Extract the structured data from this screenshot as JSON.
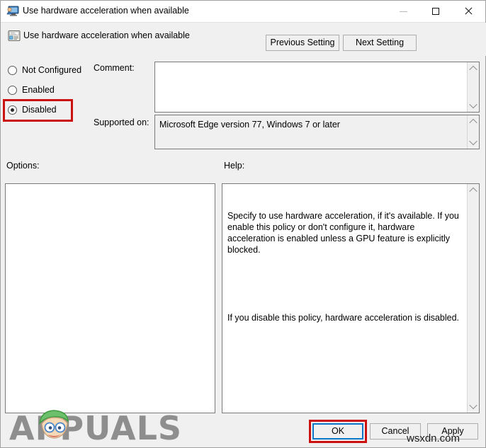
{
  "window": {
    "title": "Use hardware acceleration when available",
    "icon": "policy-monitor-icon",
    "minimize_label": "—",
    "maximize_label": "□",
    "close_label": "✕"
  },
  "header": {
    "title": "Use hardware acceleration when available",
    "icon": "policy-setting-icon",
    "previous_setting": "Previous Setting",
    "next_setting": "Next Setting"
  },
  "state_options": {
    "not_configured": "Not Configured",
    "enabled": "Enabled",
    "disabled": "Disabled",
    "selected": "Disabled"
  },
  "fields": {
    "comment_label": "Comment:",
    "comment_value": "",
    "supported_label": "Supported on:",
    "supported_value": "Microsoft Edge version 77, Windows 7 or later"
  },
  "panels": {
    "options_label": "Options:",
    "options_value": "",
    "help_label": "Help:",
    "help_paragraph_1": "Specify to use hardware acceleration, if it's available. If you enable this policy or don't configure it, hardware acceleration is enabled unless a GPU feature is explicitly blocked.",
    "help_paragraph_2": "If you disable this policy, hardware acceleration is disabled."
  },
  "footer": {
    "ok": "OK",
    "cancel": "Cancel",
    "apply": "Apply"
  },
  "watermarks": {
    "brand": "APPUALS",
    "site": "wsxdn.com"
  },
  "colors": {
    "annotation_red": "#cc1111",
    "focus_blue": "#0d76c6",
    "window_bg": "#f0f0f0",
    "field_bg": "#ffffff",
    "watermark_gray": "#8e8e8e"
  }
}
